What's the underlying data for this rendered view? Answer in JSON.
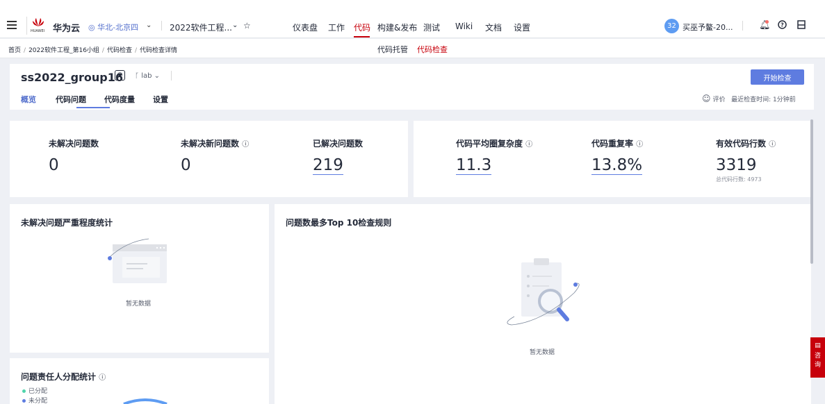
{
  "topbar": {
    "brand": "华为云",
    "region": "◎ 华北-北京四",
    "project": "2022软件工程...",
    "nav": [
      {
        "label": "仪表盘"
      },
      {
        "label": "工作"
      },
      {
        "label": "代码"
      },
      {
        "label": "构建&发布"
      },
      {
        "label": "测试"
      },
      {
        "label": "Wiki"
      },
      {
        "label": "文档"
      },
      {
        "label": "设置"
      }
    ],
    "avatar": "32",
    "username": "买巫予鳌-20...",
    "logo_sub": "HUAWEI"
  },
  "breadcrumb": {
    "items": [
      "首页",
      "2022软件工程_第16小组",
      "代码检查",
      "代码检查详情"
    ],
    "subnav": [
      "代码托管",
      "代码检查"
    ]
  },
  "header": {
    "repo": "ss2022_group16",
    "branch": "lab",
    "tabs": [
      "概览",
      "代码问题",
      "代码度量",
      "设置"
    ],
    "start_button": "开始检查",
    "rate_label": "评价",
    "last_check": "最近检查时间: 1分钟前"
  },
  "stats_left": [
    {
      "label": "未解决问题数",
      "value": "0"
    },
    {
      "label": "未解决新问题数",
      "value": "0"
    },
    {
      "label": "已解决问题数",
      "value": "219"
    }
  ],
  "stats_right": [
    {
      "label": "代码平均圈复杂度",
      "value": "11.3"
    },
    {
      "label": "代码重复率",
      "value": "13.8%"
    },
    {
      "label": "有效代码行数",
      "value": "3319",
      "sub": "总代码行数: 4973"
    }
  ],
  "panels": {
    "severity": {
      "title": "未解决问题严重程度统计",
      "empty": "暂无数据"
    },
    "top_rules": {
      "title": "问题数最多Top 10检查规则",
      "empty": "暂无数据"
    },
    "assignee": {
      "title": "问题责任人分配统计",
      "legend": [
        "已分配",
        "未分配"
      ]
    }
  },
  "consult": "咨询",
  "colors": {
    "accent": "#5e7ce0",
    "brand_red": "#c7000b",
    "assigned": "#50d4ab",
    "unassigned": "#5e7ce0"
  }
}
